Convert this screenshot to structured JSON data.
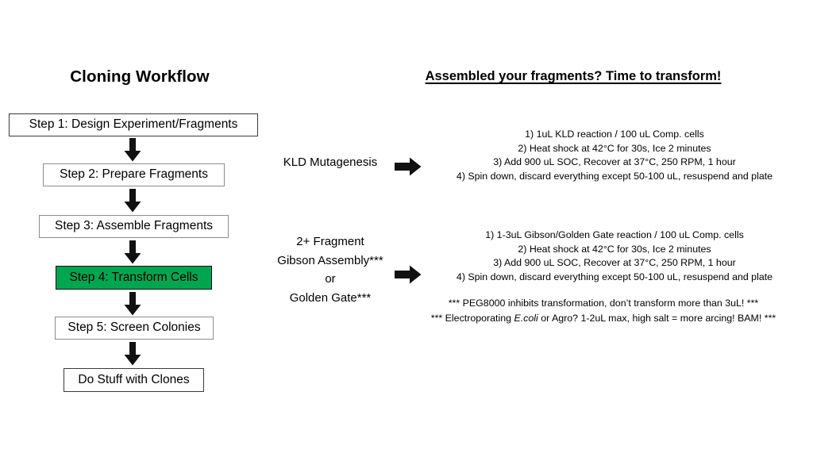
{
  "colors": {
    "highlight_green": "#00a550",
    "box_border": "#8c8c8c",
    "box_border_dark": "#3a3a3a",
    "text": "#000000",
    "background": "#ffffff"
  },
  "workflow": {
    "title": "Cloning Workflow",
    "steps": [
      {
        "label": "Step 1: Design Experiment/Fragments",
        "highlighted": false
      },
      {
        "label": "Step 2: Prepare Fragments",
        "highlighted": false
      },
      {
        "label": "Step 3: Assemble Fragments",
        "highlighted": false
      },
      {
        "label": "Step 4: Transform Cells",
        "highlighted": true
      },
      {
        "label": "Step 5: Screen Colonies",
        "highlighted": false
      },
      {
        "label": "Do Stuff with Clones",
        "highlighted": false
      }
    ]
  },
  "transform": {
    "title": "Assembled your fragments? Time to transform!",
    "methods": [
      {
        "label_lines": [
          "KLD Mutagenesis"
        ],
        "steps": [
          "1) 1uL KLD reaction / 100 uL Comp. cells",
          "2) Heat shock at 42°C for 30s, Ice 2 minutes",
          "3) Add 900 uL SOC, Recover at 37°C, 250 RPM, 1 hour",
          "4) Spin down, discard everything except 50-100 uL, resuspend and plate"
        ]
      },
      {
        "label_lines": [
          "2+ Fragment",
          "Gibson Assembly***",
          "or",
          "Golden Gate***"
        ],
        "steps": [
          "1) 1-3uL Gibson/Golden Gate reaction / 100 uL Comp. cells",
          "2) Heat shock at 42°C for 30s, Ice 2 minutes",
          "3) Add 900 uL SOC, Recover at 37°C, 250 RPM, 1 hour",
          "4) Spin down, discard everything except 50-100 uL, resuspend and plate"
        ]
      }
    ],
    "footnotes": {
      "line1": "*** PEG8000 inhibits transformation, don’t transform more than 3uL! ***",
      "line2_pre": "*** Electroporating ",
      "line2_italic": "E.coli",
      "line2_post": " or Agro? 1-2uL max, high salt = more arcing! BAM! ***"
    }
  }
}
